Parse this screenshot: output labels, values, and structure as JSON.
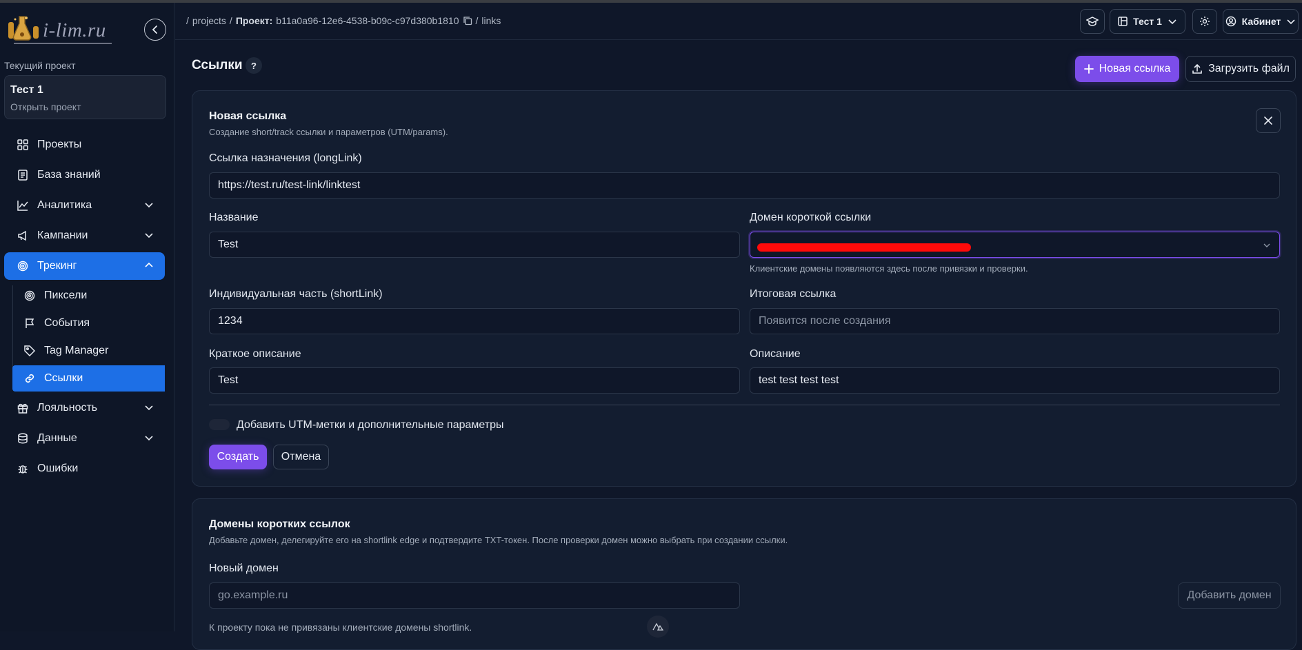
{
  "brand": {
    "logo_text": "i-lim.ru"
  },
  "sidebar": {
    "current_project_label": "Текущий проект",
    "project": {
      "name": "Тест 1",
      "open_label": "Открыть проект"
    },
    "items": [
      {
        "label": "Проекты",
        "icon": "grid-icon"
      },
      {
        "label": "База знаний",
        "icon": "book-icon"
      },
      {
        "label": "Аналитика",
        "icon": "chart-icon",
        "expandable": true
      },
      {
        "label": "Кампании",
        "icon": "megaphone-icon",
        "expandable": true
      },
      {
        "label": "Трекинг",
        "icon": "fingerprint-icon",
        "expandable": true,
        "expanded": true,
        "active": true
      },
      {
        "label": "Лояльность",
        "icon": "gift-icon",
        "expandable": true
      },
      {
        "label": "Данные",
        "icon": "database-icon",
        "expandable": true
      },
      {
        "label": "Ошибки",
        "icon": "bug-icon"
      }
    ],
    "tracking_sub": [
      {
        "label": "Пиксели",
        "icon": "fingerprint-icon"
      },
      {
        "label": "События",
        "icon": "flag-icon"
      },
      {
        "label": "Tag Manager",
        "icon": "tag-icon"
      },
      {
        "label": "Ссылки",
        "icon": "link-icon",
        "active": true
      }
    ]
  },
  "header": {
    "breadcrumb": {
      "projects": "projects",
      "project_label": "Проект:",
      "project_id": "b11a0a96-12e6-4538-b09c-c97d380b1810",
      "current": "links",
      "separator": "/"
    },
    "project_selector": "Тест 1",
    "cabinet": "Кабинет"
  },
  "page": {
    "title": "Ссылки",
    "help": "?",
    "new_link_button": "Новая ссылка",
    "upload_button": "Загрузить файл"
  },
  "form": {
    "title": "Новая ссылка",
    "subtitle": "Создание short/track ссылки и параметров (UTM/params).",
    "long_link": {
      "label": "Ссылка назначения (longLink)",
      "value": "https://test.ru/test-link/linktest"
    },
    "name": {
      "label": "Название",
      "value": "Test"
    },
    "domain": {
      "label": "Домен короткой ссылки",
      "hint": "Клиентские домены появляются здесь после привязки и проверки."
    },
    "short_link": {
      "label": "Индивидуальная часть (shortLink)",
      "value": "1234"
    },
    "final_link": {
      "label": "Итоговая ссылка",
      "placeholder": "Появится после создания"
    },
    "short_desc": {
      "label": "Краткое описание",
      "value": "Test"
    },
    "description": {
      "label": "Описание",
      "value": "test test test test"
    },
    "utm_toggle_label": "Добавить UTM-метки и дополнительные параметры",
    "create_button": "Создать",
    "cancel_button": "Отмена"
  },
  "domains": {
    "title": "Домены коротких ссылок",
    "subtitle": "Добавьте домен, делегируйте его на shortlink edge и подтвердите TXT-токен. После проверки домен можно выбрать при создании ссылки.",
    "new_domain_label": "Новый домен",
    "new_domain_placeholder": "go.example.ru",
    "add_button": "Добавить домен",
    "empty_text": "К проекту пока не привязаны клиентские домены shortlink."
  },
  "colors": {
    "accent": "#7c4dea",
    "active_nav": "#1d6fe6",
    "background": "#0f1729"
  }
}
